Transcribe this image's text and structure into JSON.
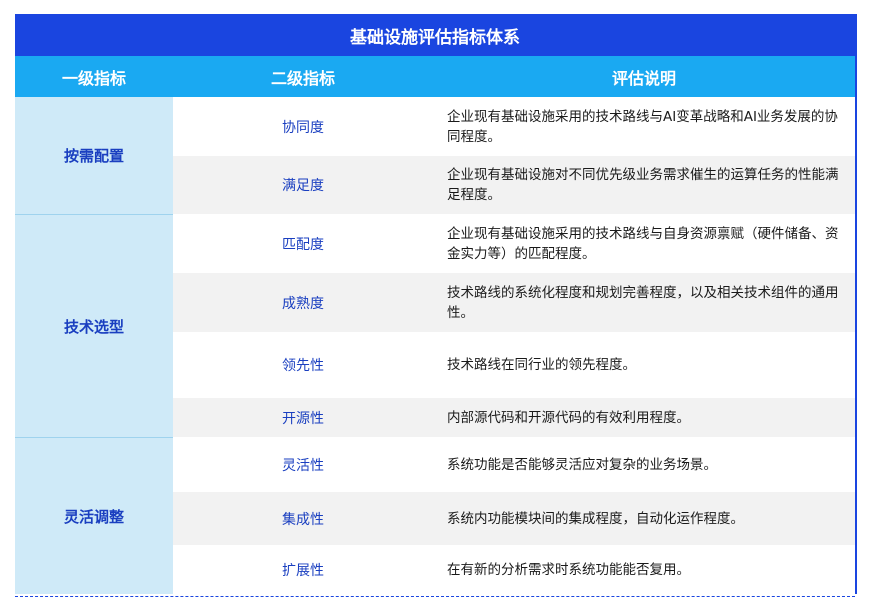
{
  "title": "基础设施评估指标体系",
  "headers": {
    "level1": "一级指标",
    "level2": "二级指标",
    "description": "评估说明"
  },
  "categories": [
    {
      "name": "按需配置",
      "rows": [
        {
          "name": "协同度",
          "desc": "企业现有基础设施采用的技术路线与AI变革战略和AI业务发展的协同程度。"
        },
        {
          "name": "满足度",
          "desc": "企业现有基础设施对不同优先级业务需求催生的运算任务的性能满足程度。"
        }
      ]
    },
    {
      "name": "技术选型",
      "rows": [
        {
          "name": "匹配度",
          "desc": "企业现有基础设施采用的技术路线与自身资源禀赋（硬件储备、资金实力等）的匹配程度。"
        },
        {
          "name": "成熟度",
          "desc": "技术路线的系统化程度和规划完善程度，以及相关技术组件的通用性。"
        },
        {
          "name": "领先性",
          "desc": "技术路线在同行业的领先程度。"
        },
        {
          "name": "开源性",
          "desc": "内部源代码和开源代码的有效利用程度。"
        }
      ]
    },
    {
      "name": "灵活调整",
      "rows": [
        {
          "name": "灵活性",
          "desc": "系统功能是否能够灵活应对复杂的业务场景。"
        },
        {
          "name": "集成性",
          "desc": "系统内功能模块间的集成程度，自动化运作程度。"
        },
        {
          "name": "扩展性",
          "desc": "在有新的分析需求时系统功能能否复用。"
        }
      ]
    }
  ]
}
